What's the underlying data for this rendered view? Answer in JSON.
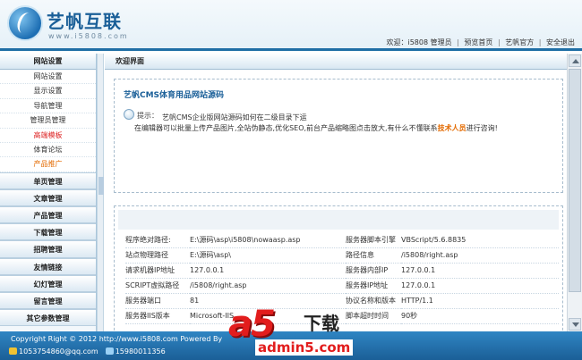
{
  "header": {
    "logo_text": "艺帆互联",
    "logo_url": "www.i5808.com",
    "welcome_text": "欢迎：i5808 管理员",
    "links": [
      "预览首页",
      "艺帆官方",
      "安全退出"
    ]
  },
  "sidebar": {
    "title": "网站设置",
    "items": [
      {
        "label": "网站设置",
        "style": "normal"
      },
      {
        "label": "显示设置",
        "style": "normal"
      },
      {
        "label": "导航管理",
        "style": "normal"
      },
      {
        "label": "管理员管理",
        "style": "normal"
      },
      {
        "label": "高端模板",
        "style": "red"
      },
      {
        "label": "体育论坛",
        "style": "normal"
      },
      {
        "label": "产品推广",
        "style": "orange"
      }
    ],
    "groups": [
      "单页管理",
      "文章管理",
      "产品管理",
      "下载管理",
      "招聘管理",
      "友情链接",
      "幻灯管理",
      "留言管理",
      "其它参数管理"
    ]
  },
  "main": {
    "title": "欢迎界面",
    "site_title": "艺帆CMS体育用品网站源码",
    "tip_label": "提示：",
    "tip_line1": "艺帆CMS企业版网站源码如何在二级目录下运",
    "tip_line2_a": "在编辑器可以批量上传产品图片,全站伪静态,优化SEO,前台产品缩略图点击放大,有什么不懂联系",
    "tip_line2_em": "技术人员",
    "tip_line2_b": "进行咨询!",
    "server_info": [
      {
        "k1": "程序绝对路径:",
        "v1": "E:\\源码\\asp\\i5808\\nowaasp.asp",
        "k2": "服务器脚本引擎",
        "v2": "VBScript/5.6.8835"
      },
      {
        "k1": "站点物理路径",
        "v1": "E:\\源码\\asp\\",
        "k2": "路径信息",
        "v2": "/i5808/right.asp"
      },
      {
        "k1": "请求机器IP地址",
        "v1": "127.0.0.1",
        "k2": "服务器内部IP",
        "v2": "127.0.0.1"
      },
      {
        "k1": "SCRIPT虚拟路径",
        "v1": "/i5808/right.asp",
        "k2": "服务器IP地址",
        "v2": "127.0.0.1"
      },
      {
        "k1": "服务器端口",
        "v1": "81",
        "k2": "协议名称和版本",
        "v2": "HTTP/1.1"
      },
      {
        "k1": "服务器IIS版本",
        "v1": "Microsoft-IIS",
        "k2": "脚本超时时间",
        "v2": "90秒"
      }
    ]
  },
  "footer": {
    "copyright": "Copyright Right © 2012 http://www.i5808.com Powered By",
    "qq": "1053754860@qq.com",
    "phone": "15980011356"
  },
  "watermark": {
    "brand": "a5",
    "label": "下载",
    "url": "admin5.com"
  }
}
